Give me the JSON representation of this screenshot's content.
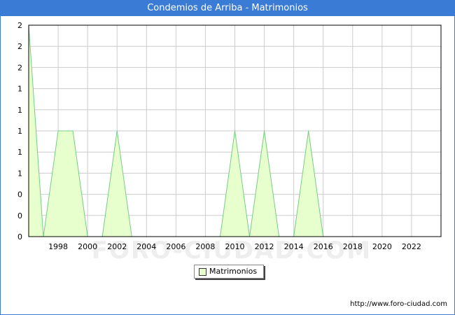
{
  "header": {
    "title": "Condemios de Arriba - Matrimonios"
  },
  "footer": {
    "source": "http://www.foro-ciudad.com"
  },
  "watermark": "FORO-CIUDAD.COM",
  "colors": {
    "titlebar": "#3a7bd5",
    "fill": "#e6ffcc",
    "line": "#77cc88",
    "grid": "#cccccc"
  },
  "chart_data": {
    "type": "area",
    "title": "Condemios de Arriba - Matrimonios",
    "xlabel": "",
    "ylabel": "",
    "x": [
      1996,
      1997,
      1998,
      1999,
      2000,
      2001,
      2002,
      2003,
      2004,
      2005,
      2006,
      2007,
      2008,
      2009,
      2010,
      2011,
      2012,
      2013,
      2014,
      2015,
      2016,
      2017,
      2018,
      2019,
      2020,
      2021,
      2022,
      2023
    ],
    "series": [
      {
        "name": "Matrimonios",
        "values": [
          2,
          0,
          1,
          1,
          0,
          0,
          1,
          0,
          0,
          0,
          0,
          0,
          0,
          0,
          1,
          0,
          1,
          0,
          0,
          1,
          0,
          0,
          0,
          0,
          0,
          0,
          0,
          0
        ]
      }
    ],
    "xlim": [
      1996,
      2024
    ],
    "ylim": [
      0,
      2
    ],
    "x_ticks": [
      "1998",
      "2000",
      "2002",
      "2004",
      "2006",
      "2008",
      "2010",
      "2012",
      "2014",
      "2016",
      "2018",
      "2020",
      "2022"
    ],
    "y_ticks": [
      "0",
      "0",
      "0",
      "1",
      "1",
      "1",
      "1",
      "1",
      "2",
      "2",
      "2"
    ],
    "grid": true,
    "legend": "bottom-center"
  }
}
